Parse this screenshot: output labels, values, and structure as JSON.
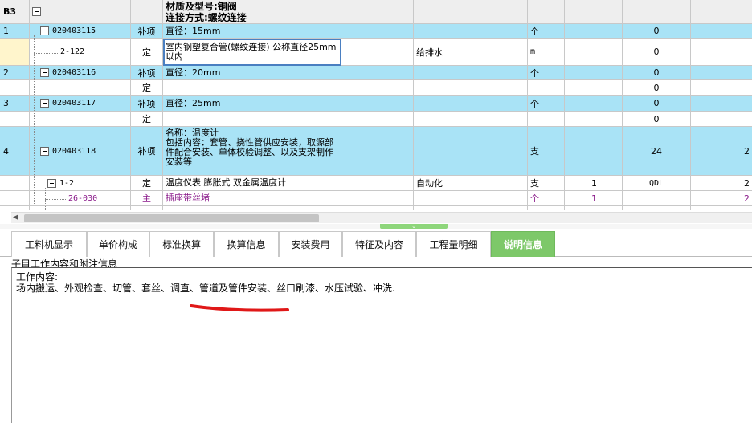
{
  "header": {
    "level": "B3",
    "desc_line1": "材质及型号:铜阀",
    "desc_line2": "连接方式:螺纹连接"
  },
  "rows": [
    {
      "num": "1",
      "code": "020403115",
      "type": "补项",
      "desc": "直径：15mm",
      "specialty": "",
      "unit": "个",
      "qty": "",
      "code2": "0",
      "last": ""
    },
    {
      "num": "",
      "code": "2-122",
      "type": "定",
      "desc": "室内钢塑复合管(螺纹连接) 公称直径25mm以内",
      "specialty": "给排水",
      "unit": "m",
      "qty": "",
      "code2": "0",
      "last": ""
    },
    {
      "num": "2",
      "code": "020403116",
      "type": "补项",
      "desc": "直径：20mm",
      "specialty": "",
      "unit": "个",
      "qty": "",
      "code2": "0",
      "last": ""
    },
    {
      "num": "",
      "code": "",
      "type": "定",
      "desc": "",
      "specialty": "",
      "unit": "",
      "qty": "",
      "code2": "0",
      "last": ""
    },
    {
      "num": "3",
      "code": "020403117",
      "type": "补项",
      "desc": "直径：25mm",
      "specialty": "",
      "unit": "个",
      "qty": "",
      "code2": "0",
      "last": ""
    },
    {
      "num": "",
      "code": "",
      "type": "定",
      "desc": "",
      "specialty": "",
      "unit": "",
      "qty": "",
      "code2": "0",
      "last": ""
    },
    {
      "num": "4",
      "code": "020403118",
      "type": "补项",
      "desc": "名称：温度计\n包括内容：套管、挠性管供应安装，取源部件配合安装、单体校验调整、以及支架制作安装等",
      "specialty": "",
      "unit": "支",
      "qty": "",
      "code2": "24",
      "last": "2"
    },
    {
      "num": "",
      "code": "1-2",
      "type": "定",
      "desc": "温度仪表 膨胀式 双金属温度计",
      "specialty": "自动化",
      "unit": "支",
      "qty": "1",
      "code2": "QDL",
      "last": "2"
    },
    {
      "num": "",
      "code": "26-030",
      "type": "主",
      "desc": "插座带丝堵",
      "specialty": "",
      "unit": "个",
      "qty": "1",
      "code2": "",
      "last": "2"
    }
  ],
  "tabs": [
    {
      "label": "工料机显示",
      "active": false
    },
    {
      "label": "单价构成",
      "active": false
    },
    {
      "label": "标准换算",
      "active": false
    },
    {
      "label": "换算信息",
      "active": false
    },
    {
      "label": "安装费用",
      "active": false
    },
    {
      "label": "特征及内容",
      "active": false
    },
    {
      "label": "工程量明细",
      "active": false
    },
    {
      "label": "说明信息",
      "active": true
    }
  ],
  "panel": {
    "title": "子目工作内容和附注信息",
    "heading": "工作内容:",
    "content": "场内搬运、外观检查、切管、套丝、调直、管道及管件安装、丝口刷漆、水压试验、冲洗."
  },
  "colors": {
    "row_blue": "#a9e3f6",
    "tab_active": "#7dc869",
    "annotation": "#e01818",
    "main_material_text": "#8a1a8a"
  }
}
